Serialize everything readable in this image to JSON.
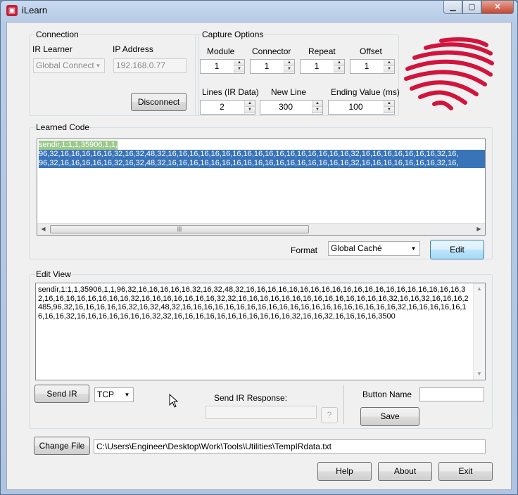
{
  "window": {
    "title": "iLearn",
    "controls": {
      "minimize": "▁",
      "maximize": "▢",
      "close": "✕"
    }
  },
  "connection": {
    "group_label": "Connection",
    "ir_learner_label": "IR Learner",
    "ir_learner_value": "Global Connect",
    "ip_address_label": "IP Address",
    "ip_address_value": "192.168.0.77",
    "disconnect_label": "Disconnect"
  },
  "capture": {
    "group_label": "Capture Options",
    "module_label": "Module",
    "module_value": "1",
    "connector_label": "Connector",
    "connector_value": "1",
    "repeat_label": "Repeat",
    "repeat_value": "1",
    "offset_label": "Offset",
    "offset_value": "1",
    "lines_label": "Lines (IR Data)",
    "lines_value": "2",
    "newline_label": "New Line",
    "newline_value": "300",
    "ending_label": "Ending Value (ms)",
    "ending_value": "100"
  },
  "learned": {
    "group_label": "Learned Code",
    "lines": [
      "sendir,1:1,1,35906,1,1,",
      "96,32,16,16,16,16,16,32,16,32,48,32,16,16,16,16,16,16,16,16,16,16,16,16,16,16,16,16,16,32,16,16,16,16,16,16,16,32,16,",
      "96,32,16,16,16,16,16,32,16,32,48,32,16,16,16,16,16,16,16,16,16,16,16,16,16,16,16,16,16,32,16,16,16,16,16,16,16,32,16,"
    ],
    "format_label": "Format",
    "format_value": "Global Caché",
    "edit_label": "Edit"
  },
  "edit_view": {
    "group_label": "Edit View",
    "text": "sendir,1:1,1,35906,1,1,96,32,16,16,16,16,16,32,16,32,48,32,16,16,16,16,16,16,16,16,16,16,16,16,16,16,16,16,16,16,16,16,32,16,16,16,16,16,16,16,16,32,16,16,16,16,16,16,16,32,32,16,16,16,16,16,16,16,16,16,16,16,16,16,16,32,16,16,32,16,16,16,2485,96,32,16,16,16,16,16,32,16,32,48,32,16,16,16,16,16,16,16,16,16,16,16,16,16,16,16,16,16,16,16,16,32,16,16,16,16,16,16,16,16,32,16,16,16,16,16,16,16,32,32,16,16,16,16,16,16,16,16,16,16,16,32,16,16,32,16,16,16,16,3500",
    "send_ir_label": "Send IR",
    "protocol_value": "TCP",
    "response_label": "Send IR Response:",
    "response_value": "",
    "help_q": "?",
    "button_name_label": "Button Name",
    "button_name_value": "",
    "save_label": "Save"
  },
  "file": {
    "change_label": "Change File",
    "path": "C:\\Users\\Engineer\\Desktop\\Work\\Tools\\Utilities\\TempIRdata.txt"
  },
  "footer": {
    "help_label": "Help",
    "about_label": "About",
    "exit_label": "Exit"
  },
  "colors": {
    "logo": "#d2143c",
    "selection": "#3a74b8",
    "selection_first": "#9bc88b"
  }
}
